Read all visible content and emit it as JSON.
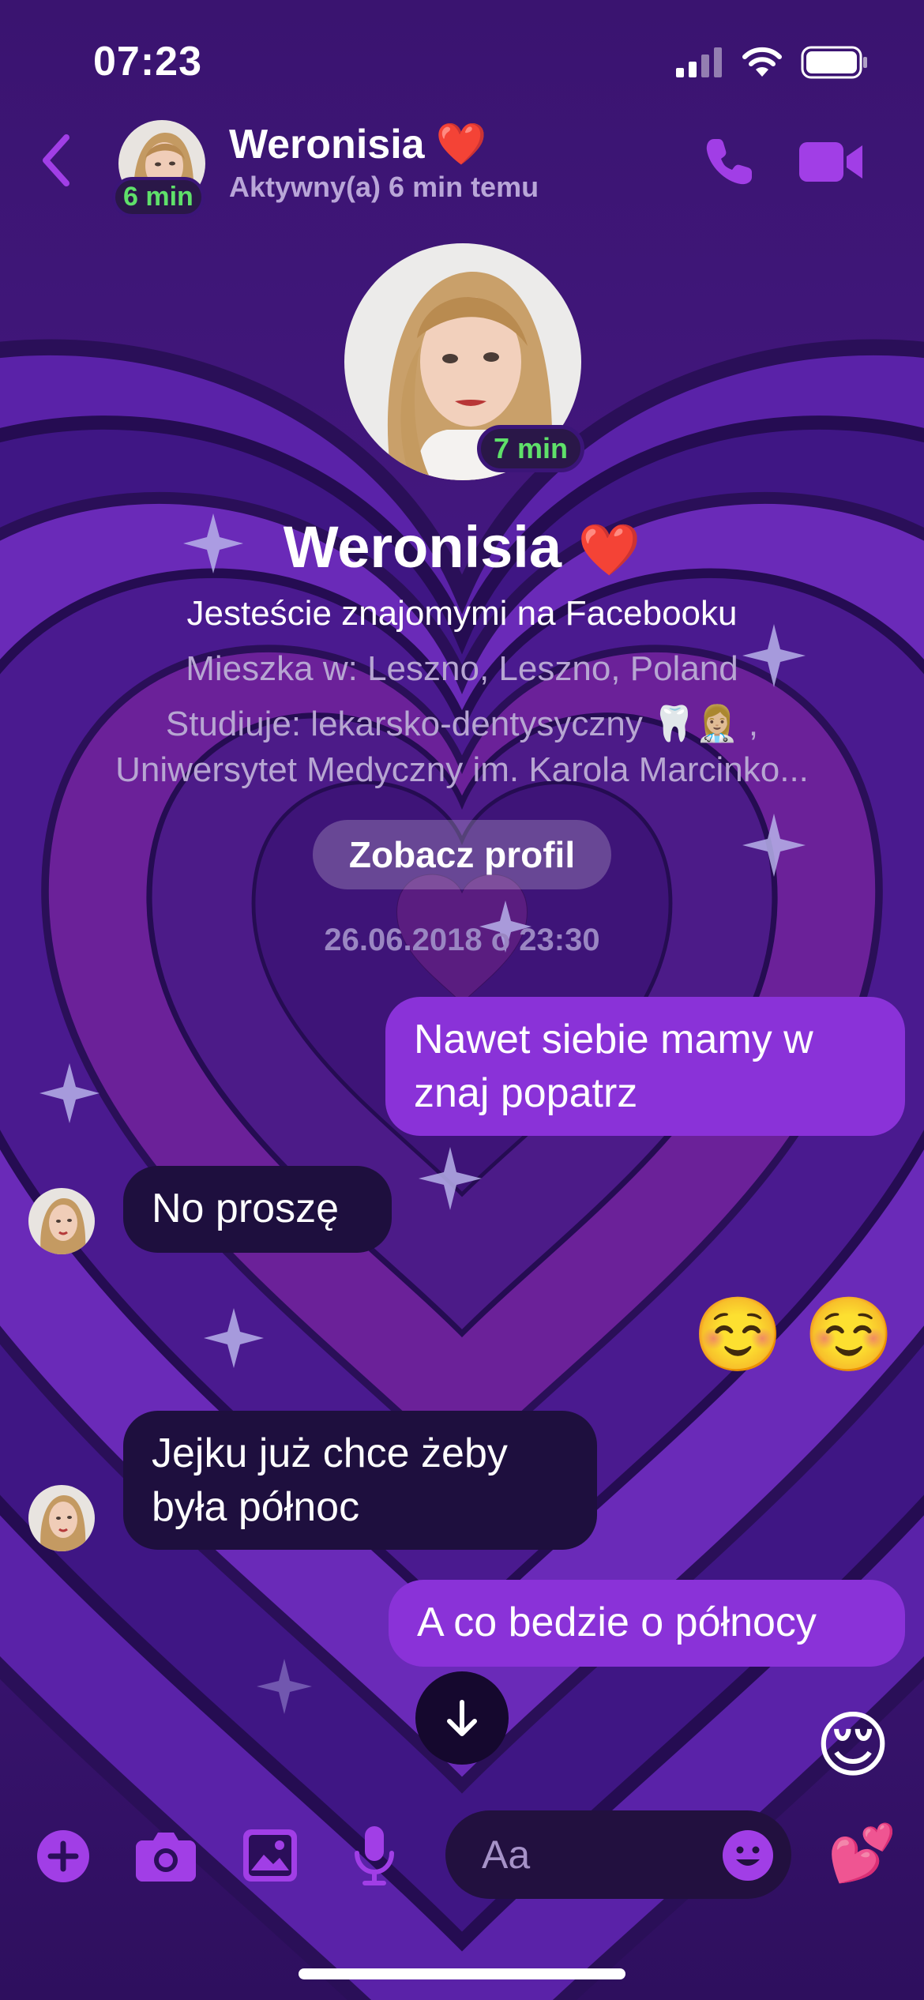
{
  "status_bar": {
    "time": "07:23"
  },
  "header": {
    "name": "Weronisia",
    "name_emoji": "❤️",
    "active_badge": "6 min",
    "status": "Aktywny(a) 6 min temu"
  },
  "profile": {
    "active_badge": "7 min",
    "name": "Weronisia",
    "name_emoji": "❤️",
    "friends_text": "Jesteście znajomymi na Facebooku",
    "lives_in": "Mieszka w: Leszno, Leszno, Poland",
    "studies_line1": "Studiuje: lekarsko-dentysyczny 🦷👩🏼‍⚕️ ,",
    "studies_line2": "Uniwersytet Medyczny im. Karola Marcinko...",
    "see_profile_label": "Zobacz profil",
    "timestamp": "26.06.2018 o 23:30"
  },
  "messages": [
    {
      "direction": "outgoing",
      "text": "Nawet siebie mamy w znaj popatrz"
    },
    {
      "direction": "incoming",
      "text": "No proszę"
    },
    {
      "direction": "outgoing",
      "text": "☺️ ☺️"
    },
    {
      "direction": "incoming",
      "text": "Jejku już chce żeby była północ"
    },
    {
      "direction": "outgoing",
      "text": "A co bedzie o północy"
    },
    {
      "direction": "outgoing",
      "text": "😌"
    }
  ],
  "composer": {
    "placeholder": "Aa",
    "reaction_emoji": "💕"
  },
  "colors": {
    "accent": "#9b3fe0",
    "outgoing_bubble": "#8a32d8",
    "incoming_bubble": "#1e0f3e",
    "background": "#3b1578",
    "active_green": "#5fe06a"
  }
}
